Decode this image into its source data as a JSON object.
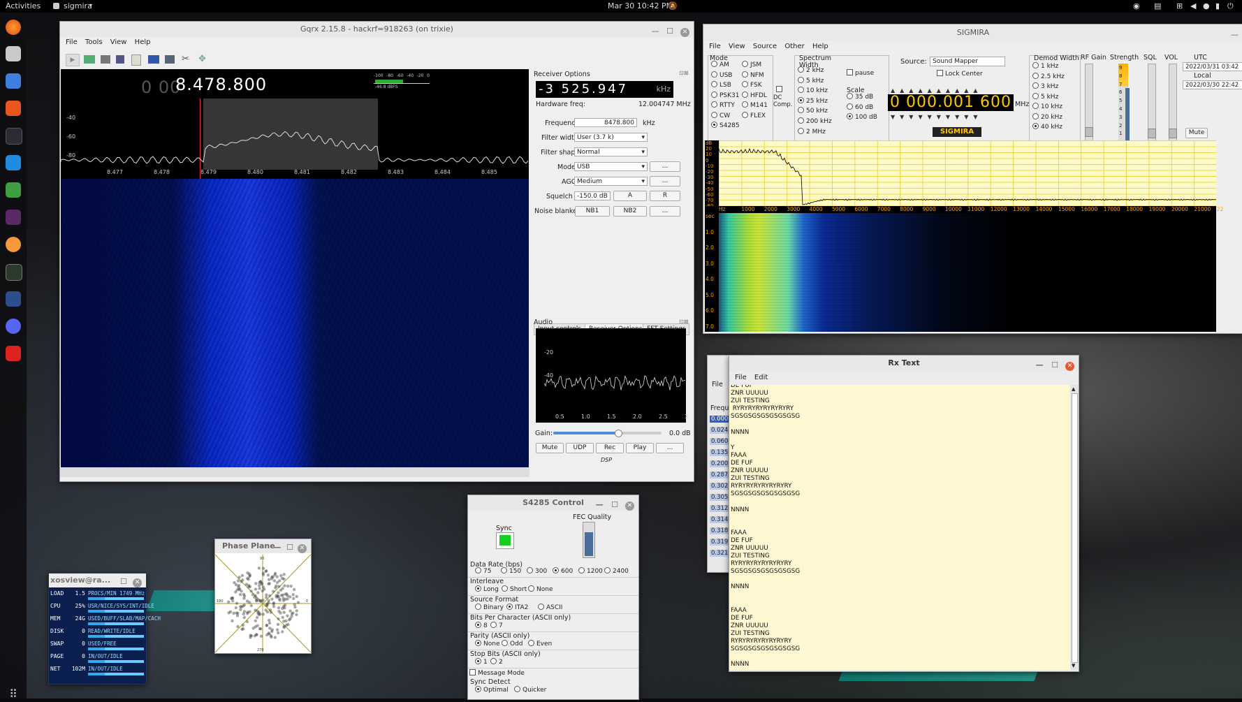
{
  "topbar": {
    "activities": "Activities",
    "app": "sigmira",
    "datetime": "Mar 30  10:42 PM"
  },
  "gqrx": {
    "title": "Gqrx 2.15.8 - hackrf=918263 (on trixie)",
    "menu": [
      "File",
      "Tools",
      "View",
      "Help"
    ],
    "freq_dim": "0 00",
    "freq_main": "8.478.800",
    "meter_ticks": [
      "-100",
      "-80",
      "-60",
      "-40",
      "-20",
      "0"
    ],
    "meter_dbfs": "-46.8 dBFS",
    "y_ticks": [
      "-40",
      "-60",
      "-80"
    ],
    "x_ticks": [
      "8.477",
      "8.478",
      "8.479",
      "8.480",
      "8.481",
      "8.482",
      "8.483",
      "8.484",
      "8.485"
    ],
    "receiver": {
      "header": "Receiver Options",
      "offset": "-3 525.947",
      "offset_unit": "kHz",
      "hw_label": "Hardware freq:",
      "hw_value": "12.004747 MHz",
      "freq_label": "Frequency",
      "freq_value": "8478.800",
      "freq_unit": "kHz",
      "fw_label": "Filter width",
      "fw_value": "User (3.7 k)",
      "fs_label": "Filter shape",
      "fs_value": "Normal",
      "mode_label": "Mode",
      "mode_value": "USB",
      "agc_label": "AGC",
      "agc_value": "Medium",
      "sq_label": "Squelch",
      "sq_value": "-150.0 dB",
      "sq_a": "A",
      "sq_r": "R",
      "nb_label": "Noise blanker",
      "nb1": "NB1",
      "nb2": "NB2",
      "more": "..."
    },
    "tabs": [
      "Input controls",
      "Receiver Options",
      "FFT Settings"
    ],
    "audio": {
      "header": "Audio",
      "y_ticks": [
        "-20",
        "-40"
      ],
      "x_ticks": [
        "0.5",
        "1.0",
        "1.5",
        "2.0",
        "2.5",
        "3"
      ],
      "gain_label": "Gain:",
      "gain_value": "0.0 dB",
      "gain_level": 0.6,
      "buttons": [
        "Mute",
        "UDP",
        "Rec",
        "Play",
        "..."
      ],
      "dsp": "DSP"
    }
  },
  "sigmira": {
    "title": "SIGMIRA",
    "menu": [
      "File",
      "View",
      "Source",
      "Other",
      "Help"
    ],
    "mode_label": "Mode",
    "modes_left": [
      "AM",
      "USB",
      "LSB",
      "PSK31",
      "RTTY",
      "CW",
      "S4285"
    ],
    "modes_right": [
      "JSM",
      "NFM",
      "FSK",
      "HFDL",
      "M141",
      "FLEX"
    ],
    "dc_comp": "DC Comp.",
    "spectrum_label": "Spectrum",
    "width_label": "Width",
    "widths": [
      "2 kHz",
      "5 kHz",
      "10 kHz",
      "25 kHz",
      "50 kHz",
      "200 kHz",
      "2 MHz"
    ],
    "pause": "pause",
    "scale_label": "Scale",
    "scales": [
      "35 dB",
      "60 dB",
      "100 dB"
    ],
    "source_label": "Source:",
    "source_value": "Sound Mapper",
    "lock_center": "Lock Center",
    "freq_display": "0 000.001 600",
    "freq_unit": "MHz",
    "brand": "SIGMIRA",
    "demod_label": "Demod Width",
    "demods": [
      "1 kHz",
      "2.5 kHz",
      "3 kHz",
      "5 kHz",
      "10 kHz",
      "20 kHz",
      "40 kHz"
    ],
    "rf_gain": "RF Gain",
    "strength": "Strength",
    "sql": "SQL",
    "vol": "VOL",
    "utc": "UTC",
    "utc_value": "2022/03/31  03:42",
    "local": "Local",
    "local_value": "2022/03/30  22:42",
    "mute": "Mute",
    "strength_ticks": [
      "9",
      "8",
      "7",
      "6",
      "5",
      "4",
      "3",
      "2",
      "1"
    ],
    "spec_y": [
      "dB",
      "20",
      "10",
      "0",
      "-10",
      "-20",
      "-30",
      "-40",
      "-50",
      "-60",
      "-70",
      "-80"
    ],
    "spec_x": [
      "Hz",
      "1000",
      "2000",
      "3000",
      "4000",
      "5000",
      "6000",
      "7000",
      "8000",
      "9000",
      "10000",
      "11000",
      "12000",
      "13000",
      "14000",
      "15000",
      "16000",
      "17000",
      "18000",
      "19000",
      "20000",
      "21000",
      "22"
    ],
    "wf_y": [
      "sec",
      "1.0",
      "2.0",
      "3.0",
      "4.0",
      "5.0",
      "6.0",
      "7.0"
    ]
  },
  "rxtext": {
    "title": "Rx Text",
    "menu": [
      "File",
      "Edit"
    ],
    "lines": [
      "DE FUF",
      "ZNR UUUUU",
      "ZUI TESTING",
      " RYRYRYRYRYRYRYRY",
      "SGSGSGSGSGSGSGSG",
      "",
      "NNNN",
      "",
      "Y",
      "FAAA",
      "DE FUF",
      "ZNR UUUUU",
      "ZUI TESTING",
      "RYRYRYRYRYRYRYRY",
      "SGSGSGSGSGSGSGSG",
      "",
      "NNNN",
      "",
      "",
      "FAAA",
      "DE FUF",
      "ZNR UUUUU",
      "ZUI TESTING",
      "RYRYRYRYRYRYRYRY",
      "SGSGSGSGSGSGSGSG",
      "",
      "NNNN",
      "",
      "",
      "FAAA",
      "DE FUF",
      "ZNR UUUUU",
      "ZUI TESTING",
      "RYRYRYRYRYRYRYRY",
      "SGSGSGSGSGSGSGSG",
      "",
      "NNNN"
    ],
    "behind": {
      "file": "File",
      "freq": "Frequ",
      "values": [
        "0.000",
        "0.024",
        "0.060",
        "0.135",
        "0.200",
        "0.287",
        "0.302",
        "0.305",
        "0.312",
        "0.314",
        "0.318",
        "0.319",
        "0.321"
      ]
    }
  },
  "s4285": {
    "title": "S4285 Control",
    "sync": "Sync",
    "fec": "FEC Quality",
    "fec_level": 0.75,
    "rate_label": "Data Rate (bps)",
    "rates": [
      "75",
      "150",
      "300",
      "600",
      "1200",
      "2400"
    ],
    "interleave_label": "Interleave",
    "interleaves": [
      "Long",
      "Short",
      "None"
    ],
    "source_format_label": "Source Format",
    "formats": [
      "Binary",
      "ITA2",
      "ASCII"
    ],
    "bits_label": "Bits Per Character  (ASCII only)",
    "bits": [
      "8",
      "7"
    ],
    "parity_label": "Parity  (ASCII only)",
    "parities": [
      "None",
      "Odd",
      "Even"
    ],
    "stop_label": "Stop Bits  (ASCII only)",
    "stops": [
      "1",
      "2"
    ],
    "message_mode": "Message Mode",
    "sync_detect_label": "Sync Detect",
    "sync_detects": [
      "Optimal",
      "Quicker"
    ]
  },
  "phase": {
    "title": "Phase Plane",
    "ticks": [
      "90",
      "180",
      "270",
      "0"
    ]
  },
  "xosview": {
    "title": "xosview@ra...",
    "rows": [
      {
        "label": "LOAD",
        "value": "1.5",
        "fields": "PROCS/MIN 1749 MHz"
      },
      {
        "label": "CPU",
        "value": "25%",
        "fields": "USR/NICE/SYS/INT/IDLE"
      },
      {
        "label": "MEM",
        "value": "24G",
        "fields": "USED/BUFF/SLAB/MAP/CACH"
      },
      {
        "label": "DISK",
        "value": "0",
        "fields": "READ/WRITE/IDLE"
      },
      {
        "label": "SWAP",
        "value": "0",
        "fields": "USED/FREE"
      },
      {
        "label": "PAGE",
        "value": "0",
        "fields": "IN/OUT/IDLE"
      },
      {
        "label": "NET",
        "value": "102M",
        "fields": "IN/OUT/IDLE"
      }
    ]
  }
}
